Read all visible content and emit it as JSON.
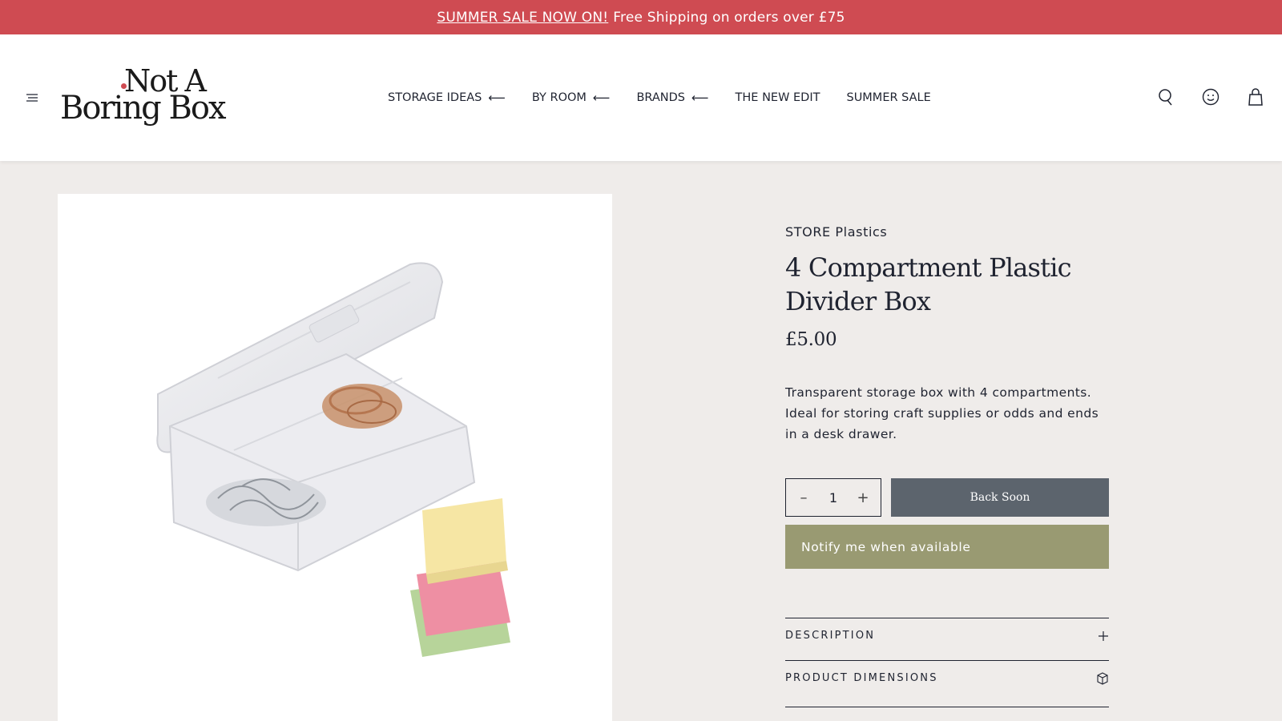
{
  "announcement": {
    "sale_link": "SUMMER SALE NOW ON!",
    "text": "Free Shipping on orders over £75",
    "color": "#cf4b52"
  },
  "logo": {
    "line1": "Not A",
    "line2": "Boring Box"
  },
  "nav": [
    {
      "label": "STORAGE IDEAS",
      "arrow": "⟵"
    },
    {
      "label": "BY ROOM",
      "arrow": "⟵"
    },
    {
      "label": "BRANDS",
      "arrow": "⟵"
    },
    {
      "label": "THE NEW EDIT",
      "arrow": ""
    },
    {
      "label": "SUMMER SALE",
      "arrow": ""
    }
  ],
  "header_icons": [
    "search-icon",
    "account-icon",
    "bag-icon"
  ],
  "product": {
    "brand": "STORE Plastics",
    "title": "4 Compartment Plastic Divider Box",
    "price": "£5.00",
    "description": "Transparent storage box with 4 compartments. Ideal for storing craft supplies or odds and ends in a desk drawer.",
    "quantity": "1",
    "back_soon_label": "Back Soon",
    "notify_label": "Notify me when available"
  },
  "accordion": [
    {
      "label": "DESCRIPTION",
      "icon": "plus-icon"
    },
    {
      "label": "PRODUCT DIMENSIONS",
      "icon": "box-icon"
    }
  ],
  "colors": {
    "accent": "#cf4b52",
    "button_dark": "#5c646d",
    "button_olive": "#999a72",
    "page_bg": "#efecea"
  }
}
